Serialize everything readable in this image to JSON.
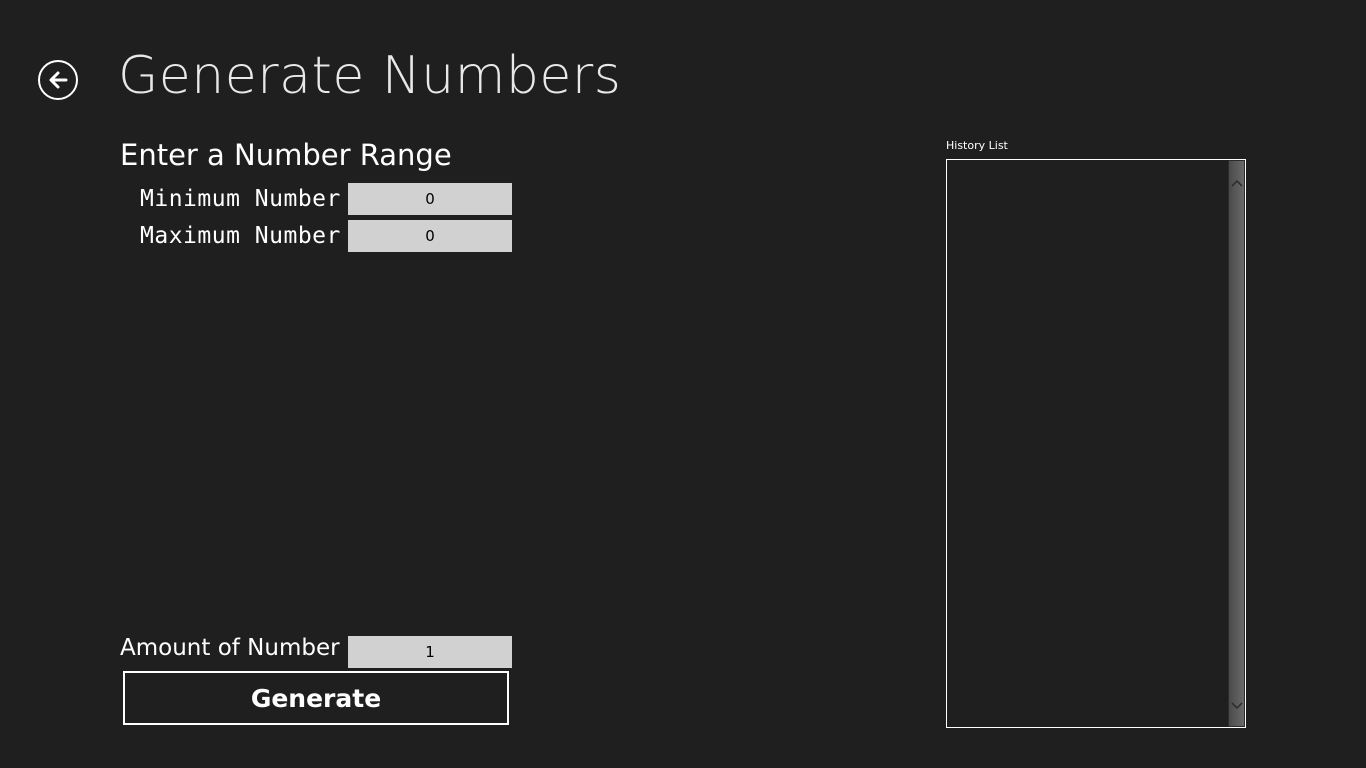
{
  "page": {
    "title": "Generate Numbers"
  },
  "range_section": {
    "heading": "Enter a Number Range",
    "minimum": {
      "label": "Minimum Number",
      "value": "0"
    },
    "maximum": {
      "label": "Maximum Number",
      "value": "0"
    }
  },
  "amount": {
    "label": "Amount of Number",
    "value": "1"
  },
  "actions": {
    "generate_label": "Generate"
  },
  "history": {
    "label": "History List",
    "items": []
  },
  "icons": {
    "back": "back-arrow-icon",
    "scroll_up": "chevron-up-icon",
    "scroll_down": "chevron-down-icon"
  },
  "colors": {
    "background": "#1f1f1f",
    "foreground": "#ffffff",
    "input_background": "#d1d1d1"
  }
}
